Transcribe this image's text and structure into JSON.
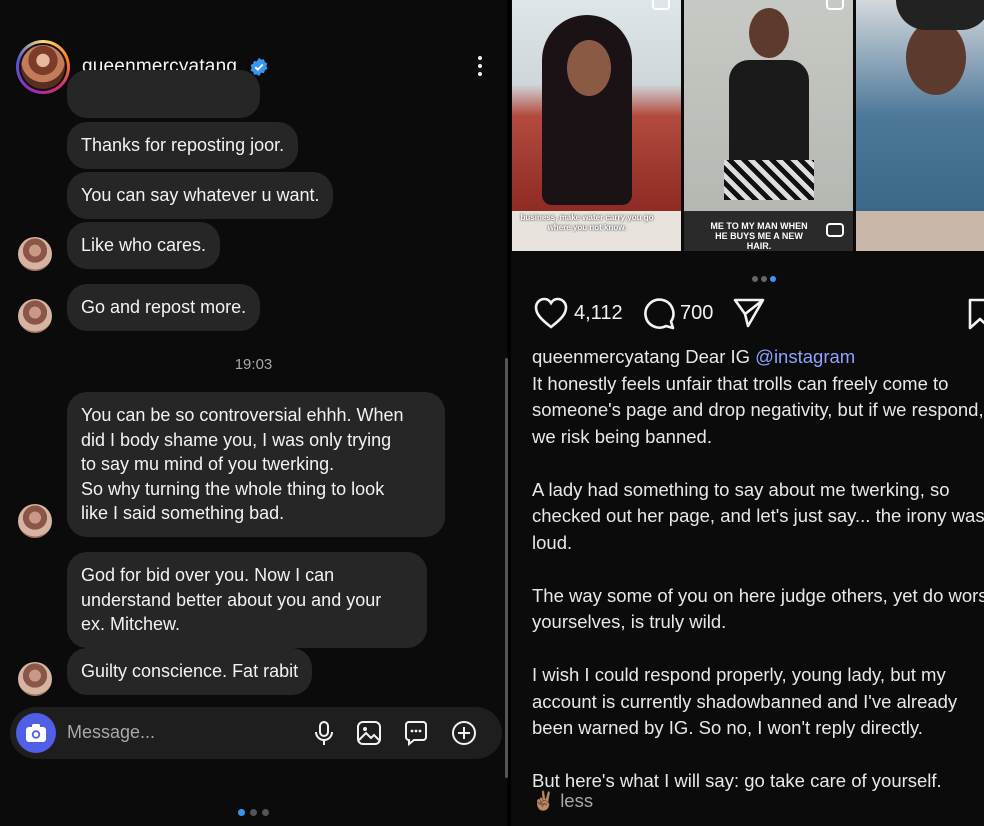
{
  "dm": {
    "username": "queenmercyatang",
    "messages": [
      {
        "text": "Thanks for reposting joor."
      },
      {
        "text": "You can say whatever u want."
      },
      {
        "text": "Like who cares."
      },
      {
        "text": "Go and repost more."
      },
      {
        "text": "You can be so controversial ehhh. When\ndid I body shame you, I was only trying\nto say mu mind of you twerking.\nSo why turning the whole thing to look\nlike I said something bad."
      },
      {
        "text": "God for bid over you. Now I can\nunderstand better about you and your\nex. Mitchew."
      },
      {
        "text": "Guilty conscience.  Fat rabit"
      }
    ],
    "timestamp": "19:03",
    "composer_placeholder": "Message...",
    "icons": [
      "camera-icon",
      "microphone-icon",
      "gallery-icon",
      "sticker-icon",
      "add-icon"
    ]
  },
  "post": {
    "thumbnails": [
      {
        "caption": "business, make water carry you go where you not know."
      },
      {
        "caption": "ME TO MY MAN WHEN HE BUYS ME A NEW HAIR."
      },
      {
        "caption": ""
      }
    ],
    "likes": "4,112",
    "comments": "700",
    "caption_username": "queenmercyatang",
    "caption_intro": "Dear IG",
    "caption_mention": "@instagram",
    "caption_body": "It honestly feels unfair that trolls can freely come to someone's page and drop negativity, but if we respond, we risk being banned.\n\nA lady had something to say about me twerking, so checked out her page, and let's just say... the irony was loud.\n\nThe way some of you on here judge others, yet do worse yourselves, is truly wild.\n\nI wish I could respond properly, young lady, but my account is currently shadowbanned and I've already been warned by IG. So no, I won't reply directly.\n\nBut here's what I will say: go take care of yourself.",
    "less_emoji": "✌🏽",
    "less_label": "less"
  },
  "colors": {
    "accent_blue": "#3897f0",
    "camera_button": "#4f5fe6",
    "bubble": "#262626",
    "mention": "#8ea2ff"
  }
}
